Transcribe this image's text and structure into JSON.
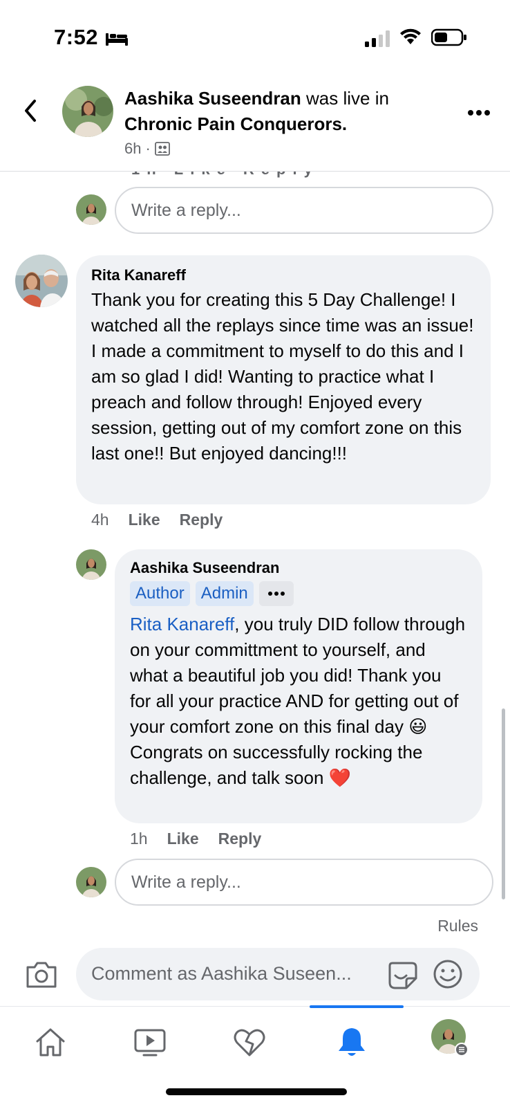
{
  "status_bar": {
    "time": "7:52",
    "icons": [
      "bed-icon",
      "signal-icon",
      "wifi-icon",
      "battery-icon"
    ]
  },
  "header": {
    "author": "Aashika Suseendran",
    "action": " was live in ",
    "group": "Chronic Pain Conquerors.",
    "time": "6h",
    "separator": "·",
    "audience_icon": "group-audience-icon"
  },
  "thread": {
    "reply_placeholder": "Write a reply...",
    "comment": {
      "author": "Rita Kanareff",
      "text": "Thank you for creating this 5 Day Challenge! I watched all the replays since time was an issue! I made a commitment to myself to do this and I am so glad I did! Wanting to practice what I preach and follow through! Enjoyed every session, getting out of my comfort zone on this last one!! But enjoyed dancing!!!",
      "time": "4h",
      "like": "Like",
      "reply": "Reply"
    },
    "reply": {
      "author": "Aashika Suseendran",
      "badges": [
        "Author",
        "Admin"
      ],
      "mention": "Rita Kanareff",
      "text_1": ", you truly DID follow through on your committment to yourself, and what a beautiful job you did! Thank you for all your practice AND for getting out of your comfort zone on this final day ",
      "text_2": " Congrats on successfully rocking the challenge, and talk soon ",
      "emoji_1": "😃",
      "emoji_2": "❤️",
      "time": "1h",
      "like": "Like",
      "reply": "Reply"
    }
  },
  "footer": {
    "rules": "Rules",
    "composer_placeholder": "Comment as Aashika Suseen...",
    "tabs": [
      "home-icon",
      "video-icon",
      "dating-icon",
      "notifications-icon",
      "profile-menu-icon"
    ],
    "active_tab": "notifications-icon",
    "accent_color": "#1877f2"
  }
}
